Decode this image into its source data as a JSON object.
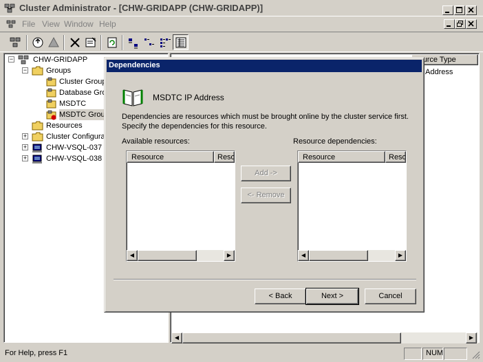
{
  "window": {
    "title": "Cluster Administrator - [CHW-GRIDAPP (CHW-GRIDAPP)]"
  },
  "menu": [
    "File",
    "View",
    "Window",
    "Help"
  ],
  "tree": {
    "root": "CHW-GRIDAPP",
    "groups_label": "Groups",
    "groups": [
      "Cluster Group",
      "Database Gro",
      "MSDTC",
      "MSDTC Group"
    ],
    "resources_label": "Resources",
    "config_label": "Cluster Configura",
    "nodes": [
      "CHW-VSQL-037",
      "CHW-VSQL-038"
    ]
  },
  "listpane": {
    "column_header": "source Type",
    "row_value": "Address"
  },
  "dialog": {
    "title": "Dependencies",
    "resource_name": "MSDTC IP Address",
    "description_line1": "Dependencies are resources which must be brought online by the cluster service first.",
    "description_line2": "Specify the dependencies for this resource.",
    "available_label": "Available resources:",
    "dependencies_label": "Resource dependencies:",
    "col_resource": "Resource",
    "col_resource_short": "Reso",
    "add_label": "Add ->",
    "remove_label": "<- Remove",
    "back_label": "< Back",
    "next_label": "Next >",
    "cancel_label": "Cancel"
  },
  "status": {
    "help_text": "For Help, press F1",
    "num": "NUM"
  },
  "colors": {
    "dialog_title_bg": "#0a246a",
    "face": "#d4d0c8"
  }
}
